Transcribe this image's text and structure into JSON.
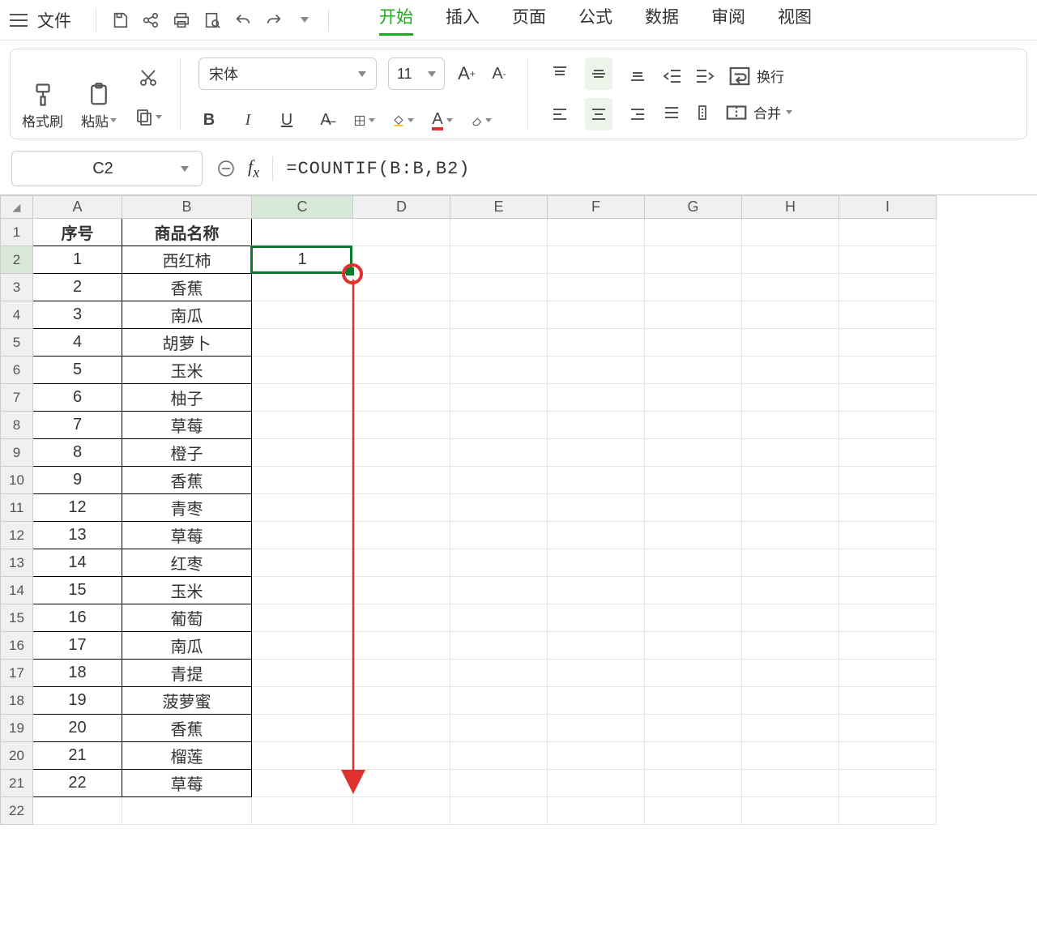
{
  "menu": {
    "file": "文件"
  },
  "tabs": {
    "start": "开始",
    "insert": "插入",
    "page": "页面",
    "formula": "公式",
    "data": "数据",
    "review": "审阅",
    "view": "视图"
  },
  "ribbon": {
    "format_painter": "格式刷",
    "paste": "粘贴",
    "font_name": "宋体",
    "font_size": "11",
    "wrap": "换行",
    "merge": "合并"
  },
  "namebox": "C2",
  "formula": "=COUNTIF(B:B,B2)",
  "columns": [
    "A",
    "B",
    "C",
    "D",
    "E",
    "F",
    "G",
    "H",
    "I"
  ],
  "headers": {
    "a": "序号",
    "b": "商品名称"
  },
  "rows": [
    {
      "n": "1",
      "name": "西红柿",
      "c": "1"
    },
    {
      "n": "2",
      "name": "香蕉",
      "c": ""
    },
    {
      "n": "3",
      "name": "南瓜",
      "c": ""
    },
    {
      "n": "4",
      "name": "胡萝卜",
      "c": ""
    },
    {
      "n": "5",
      "name": "玉米",
      "c": ""
    },
    {
      "n": "6",
      "name": "柚子",
      "c": ""
    },
    {
      "n": "7",
      "name": "草莓",
      "c": ""
    },
    {
      "n": "8",
      "name": "橙子",
      "c": ""
    },
    {
      "n": "9",
      "name": "香蕉",
      "c": ""
    },
    {
      "n": "12",
      "name": "青枣",
      "c": ""
    },
    {
      "n": "13",
      "name": "草莓",
      "c": ""
    },
    {
      "n": "14",
      "name": "红枣",
      "c": ""
    },
    {
      "n": "15",
      "name": "玉米",
      "c": ""
    },
    {
      "n": "16",
      "name": "葡萄",
      "c": ""
    },
    {
      "n": "17",
      "name": "南瓜",
      "c": ""
    },
    {
      "n": "18",
      "name": "青提",
      "c": ""
    },
    {
      "n": "19",
      "name": "菠萝蜜",
      "c": ""
    },
    {
      "n": "20",
      "name": "香蕉",
      "c": ""
    },
    {
      "n": "21",
      "name": "榴莲",
      "c": ""
    },
    {
      "n": "22",
      "name": "草莓",
      "c": ""
    }
  ],
  "col_widths": {
    "A": 110,
    "B": 160,
    "C": 125,
    "D": 120,
    "E": 120,
    "F": 120,
    "G": 120,
    "H": 120,
    "I": 120
  }
}
